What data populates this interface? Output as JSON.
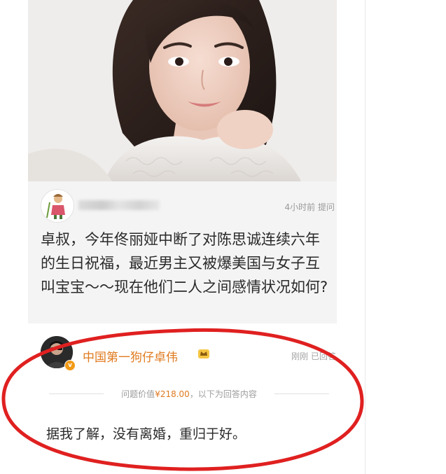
{
  "question_card": {
    "asker_meta": "4小时前 提问",
    "question_text": "卓叔，今年佟丽娅中断了对陈思诚连续六年的生日祝福，最近男主又被爆美国与女子互叫宝宝～～现在他们二人之间感情状况如何?"
  },
  "answer": {
    "answerer_name": "中国第一狗仔卓伟",
    "verified_mark": "v",
    "meta": "刚刚 已回答",
    "value_prefix": "问题价值",
    "value_price": "¥218.00",
    "value_suffix": "，以下为回答内容",
    "answer_text": "据我了解，没有离婚，重归于好。"
  },
  "colors": {
    "accent_orange": "#e07a1f",
    "highlight_red": "#e02020",
    "card_bg": "#f4f4f4"
  },
  "icons": [
    "asker-avatar-icon",
    "answerer-avatar-icon",
    "verified-badge-icon",
    "crown-badge-icon"
  ]
}
